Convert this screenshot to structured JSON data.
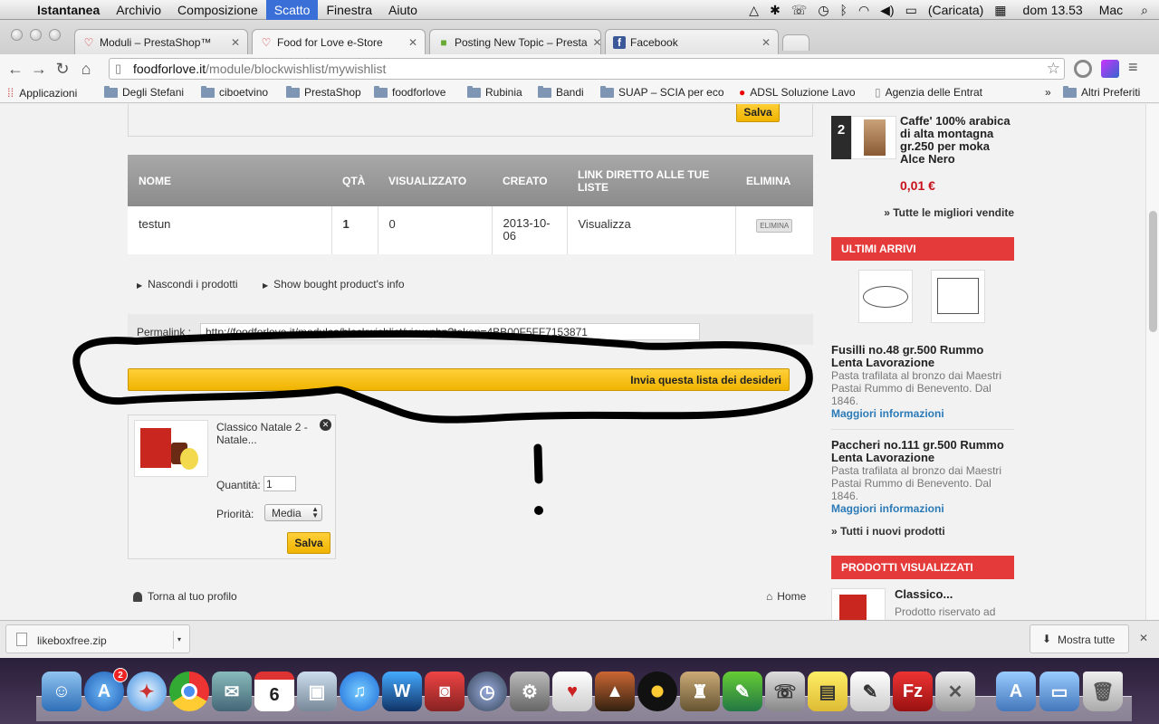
{
  "menubar": {
    "apple": "",
    "items": [
      "Istantanea",
      "Archivio",
      "Composizione",
      "Scatto",
      "Finestra",
      "Aiuto"
    ],
    "battery": "(Caricata)",
    "clock": "dom 13.53",
    "user": "Mac"
  },
  "tabs": [
    {
      "title": "Moduli – PrestaShop™",
      "icon": "heart-icon"
    },
    {
      "title": "Food for Love e-Store",
      "icon": "heart-icon"
    },
    {
      "title": "Posting New Topic – Presta",
      "icon": "puzzle-icon"
    },
    {
      "title": "Facebook",
      "icon": "facebook-icon"
    }
  ],
  "address": {
    "host": "foodforlove.it",
    "path": "/module/blockwishlist/mywishlist"
  },
  "bookmarks": [
    "Applicazioni",
    "Degli Stefani",
    "ciboetvino",
    "PrestaShop",
    "foodforlove",
    "Rubinia",
    "Bandi",
    "SUAP – SCIA per eco",
    "ADSL Soluzione Lavo",
    "Agenzia delle Entrat",
    "»",
    "Altri Preferiti"
  ],
  "wishlist": {
    "save_top": "Salva",
    "columns": [
      "NOME",
      "QTÀ",
      "VISUALIZZATO",
      "CREATO",
      "LINK DIRETTO ALLE TUE LISTE",
      "ELIMINA"
    ],
    "rows": [
      {
        "name": "testun",
        "qty": "1",
        "viewed": "0",
        "created": "2013-10-06",
        "link": "Visualizza",
        "delete": "ELIMINA"
      }
    ],
    "hide_products": "Nascondi i prodotti",
    "show_bought": "Show bought product's info",
    "permalink_label": "Permalink :",
    "permalink_value": "http://foodforlove.it/modules/blockwishlist/view.php?token=4BB00F5FF7153871",
    "send_button": "Invia questa lista dei desideri",
    "product": {
      "name": "Classico Natale 2 - Natale...",
      "qty_label": "Quantità:",
      "qty_value": "1",
      "priority_label": "Priorità:",
      "priority_value": "Media",
      "save": "Salva"
    },
    "back_profile": "Torna al tuo profilo",
    "home": "Home",
    "annotation_mark": "!"
  },
  "sidebar": {
    "best_rank": "2",
    "best_title": "Caffe' 100% arabica di alta montagna gr.250 per moka Alce Nero",
    "best_price": "0,01 €",
    "best_all": "» Tutte le migliori vendite",
    "new_head": "ULTIMI ARRIVI",
    "new_products": [
      {
        "title": "Fusilli no.48 gr.500 Rummo Lenta Lavorazione",
        "desc": "Pasta trafilata al bronzo dai Maestri Pastai Rummo di Benevento. Dal 1846.",
        "more": "Maggiori informazioni"
      },
      {
        "title": "Paccheri no.111 gr.500 Rummo Lenta Lavorazione",
        "desc": "Pasta trafilata al bronzo dai Maestri Pastai Rummo di Benevento. Dal 1846.",
        "more": "Maggiori informazioni"
      }
    ],
    "new_all": "» Tutti i nuovi prodotti",
    "viewed_head": "PRODOTTI VISUALIZZATI",
    "viewed_title": "Classico...",
    "viewed_desc": "Prodotto riservato ad"
  },
  "downloads": {
    "file": "likeboxfree.zip",
    "show_all": "Mostra tutte"
  },
  "dock": {
    "appstore_badge": "2",
    "calendar_day": "6"
  }
}
